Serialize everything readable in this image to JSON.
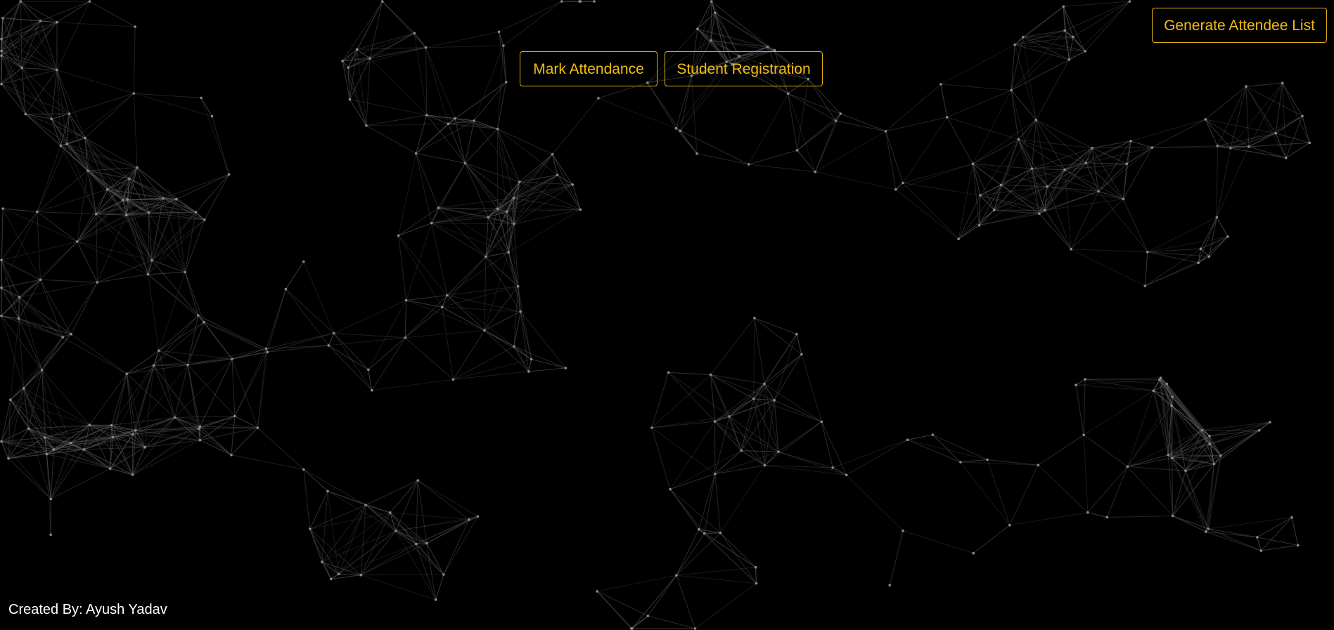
{
  "buttons": {
    "mark_attendance": "Mark Attendance",
    "student_registration": "Student Registration",
    "generate_attendee_list": "Generate Attendee List"
  },
  "footer": {
    "credit": "Created By: Ayush Yadav"
  },
  "colors": {
    "background": "#000000",
    "accent": "#f0bd14",
    "particle": "#8a8a8a",
    "link": "#5a5a5a",
    "footer_text": "#ffffff"
  },
  "background_effect": "particle-network"
}
